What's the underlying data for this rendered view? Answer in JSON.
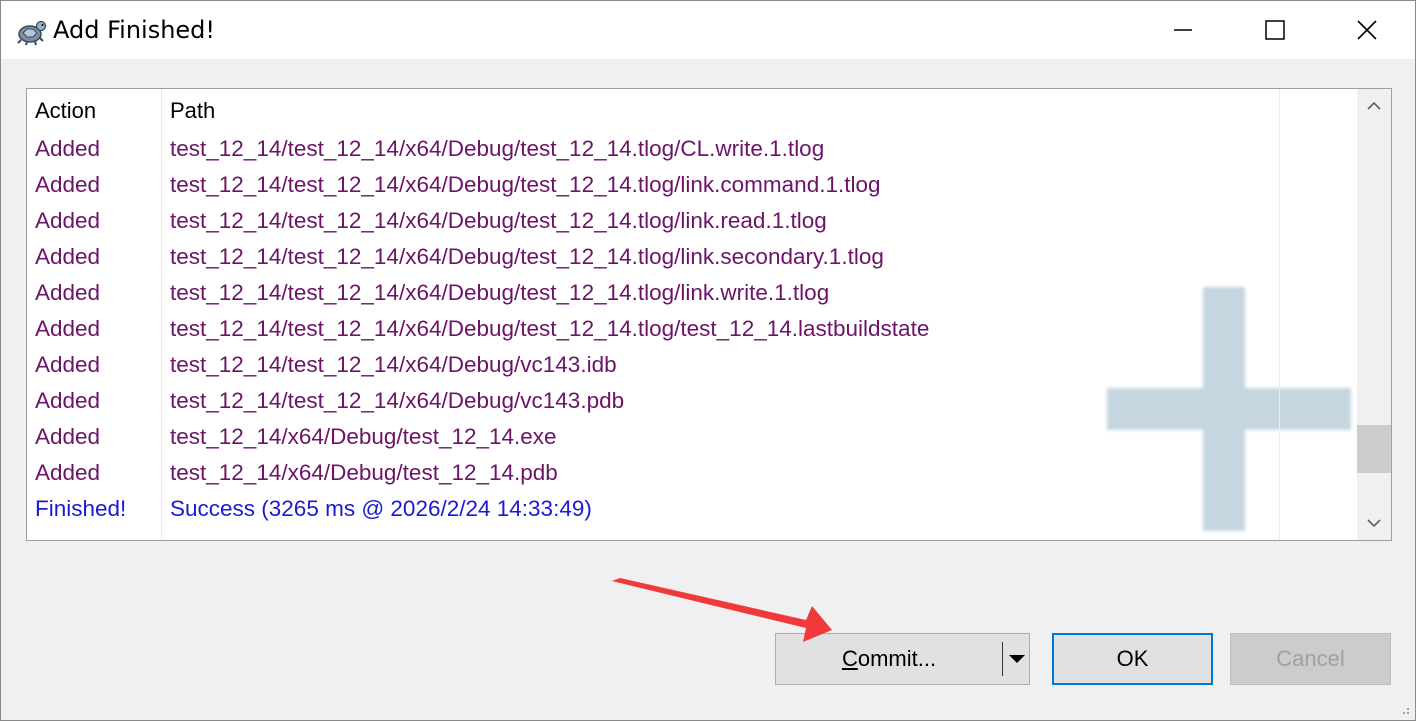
{
  "window": {
    "title": "Add Finished!",
    "icon": "tortoise-icon"
  },
  "table": {
    "headers": {
      "action": "Action",
      "path": "Path"
    },
    "rows": [
      {
        "action": "Added",
        "path": "test_12_14/test_12_14/x64/Debug/test_12_14.tlog/CL.write.1.tlog"
      },
      {
        "action": "Added",
        "path": "test_12_14/test_12_14/x64/Debug/test_12_14.tlog/link.command.1.tlog"
      },
      {
        "action": "Added",
        "path": "test_12_14/test_12_14/x64/Debug/test_12_14.tlog/link.read.1.tlog"
      },
      {
        "action": "Added",
        "path": "test_12_14/test_12_14/x64/Debug/test_12_14.tlog/link.secondary.1.tlog"
      },
      {
        "action": "Added",
        "path": "test_12_14/test_12_14/x64/Debug/test_12_14.tlog/link.write.1.tlog"
      },
      {
        "action": "Added",
        "path": "test_12_14/test_12_14/x64/Debug/test_12_14.tlog/test_12_14.lastbuildstate"
      },
      {
        "action": "Added",
        "path": "test_12_14/test_12_14/x64/Debug/vc143.idb"
      },
      {
        "action": "Added",
        "path": "test_12_14/test_12_14/x64/Debug/vc143.pdb"
      },
      {
        "action": "Added",
        "path": "test_12_14/x64/Debug/test_12_14.exe"
      },
      {
        "action": "Added",
        "path": "test_12_14/x64/Debug/test_12_14.pdb"
      },
      {
        "action": "Finished!",
        "path": "Success (3265 ms @ 2026/2/24 14:33:49)"
      }
    ],
    "scroll_position": 0.9
  },
  "buttons": {
    "commit": "Commit...",
    "ok": "OK",
    "cancel": "Cancel"
  },
  "colors": {
    "added": "#6b1468",
    "finished": "#1a1ad4",
    "watermark": "#c6d6e0",
    "annotation_arrow": "#f03a3a"
  }
}
